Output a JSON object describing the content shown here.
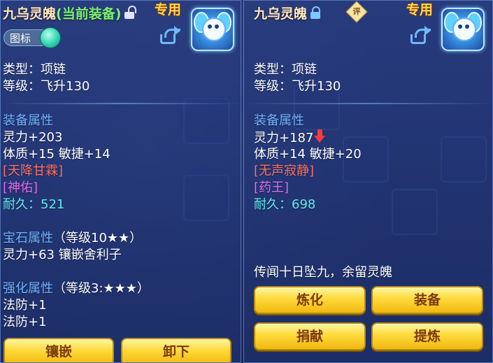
{
  "left": {
    "name": "九乌灵魄",
    "equipped_tag": "(当前装备)",
    "exclusive": "专用",
    "toggle_label": "图标",
    "type": "类型：项链",
    "level": "等级：飞升130",
    "attr_header": "装备属性",
    "attr_lines": [
      "灵力+203",
      "体质+15 敏捷+14"
    ],
    "special_red": "[天降甘霖]",
    "special_magenta": "[神佑]",
    "durability_label": "耐久：",
    "durability_value": "521",
    "gem_header": "宝石属性",
    "gem_level": "（等级10★★）",
    "gem_line": "灵力+63 镶嵌舍利子",
    "enhance_header": "强化属性",
    "enhance_level": "（等级3:★★★）",
    "enhance_lines": [
      "法防+1",
      "法防+1"
    ],
    "buttons": [
      "镶嵌",
      "卸下"
    ]
  },
  "right": {
    "name": "九乌灵魄",
    "rate_label": "评",
    "exclusive": "专用",
    "type": "类型：项链",
    "level": "等级：飞升130",
    "attr_header": "装备属性",
    "attr_lines": [
      "灵力+187",
      "体质+14 敏捷+20"
    ],
    "special_red": "[无声寂静]",
    "special_magenta": "[药王]",
    "durability_label": "耐久：",
    "durability_value": "698",
    "description": "传闻十日坠九，余留灵魄",
    "buttons": [
      "炼化",
      "装备",
      "捐献",
      "提炼"
    ]
  },
  "icons": {
    "lock": "lock-icon",
    "share": "share-icon",
    "down_arrow": "down-arrow-icon",
    "item": "necklace-icon"
  },
  "colors": {
    "section_header": "#6fb4ff",
    "special_red": "#ff7066",
    "special_magenta": "#e26ef0",
    "durability": "#5ef0f0",
    "equipped": "#7cf07a",
    "exclusive": "#ffd84a",
    "button": "#ffd93a"
  }
}
